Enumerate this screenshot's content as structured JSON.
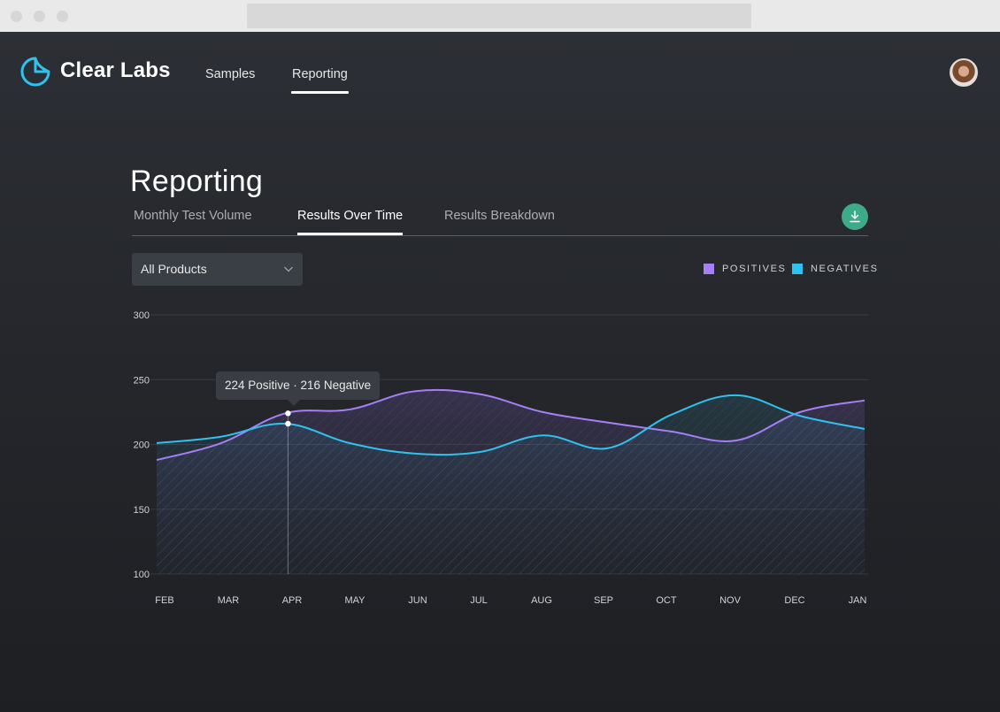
{
  "browser": {
    "url": ""
  },
  "header": {
    "brand": "Clear Labs",
    "nav": [
      {
        "label": "Samples",
        "active": false
      },
      {
        "label": "Reporting",
        "active": true
      }
    ],
    "avatar_icon": "user-avatar"
  },
  "page": {
    "title": "Reporting",
    "tabs": [
      {
        "label": "Monthly Test Volume",
        "active": false
      },
      {
        "label": "Results Over Time",
        "active": true
      },
      {
        "label": "Results Breakdown",
        "active": false
      }
    ],
    "download_icon": "download-icon",
    "product_filter": {
      "selected": "All Products",
      "icon": "chevron-down-icon"
    }
  },
  "colors": {
    "positives": "#a57ff5",
    "negatives": "#2fc2ee",
    "accent_green": "#3dab88"
  },
  "chart_data": {
    "type": "area",
    "title": "Results Over Time",
    "xlabel": "",
    "ylabel": "",
    "categories": [
      "FEB",
      "MAR",
      "APR",
      "MAY",
      "JUN",
      "JUL",
      "AUG",
      "SEP",
      "OCT",
      "NOV",
      "DEC",
      "JAN"
    ],
    "series": [
      {
        "name": "POSITIVES",
        "color": "#a57ff5",
        "values": [
          188,
          201,
          224,
          227,
          241,
          239,
          225,
          217,
          210,
          203,
          225,
          234
        ]
      },
      {
        "name": "NEGATIVES",
        "color": "#2fc2ee",
        "values": [
          201,
          206,
          216,
          201,
          193,
          194,
          207,
          197,
          223,
          238,
          222,
          212
        ]
      }
    ],
    "yticks": [
      100,
      150,
      200,
      250,
      300
    ],
    "ylim": [
      100,
      300
    ],
    "grid": true,
    "legend": "top-right",
    "tooltip": {
      "category": "APR",
      "text": "224 Positive · 216 Negative"
    }
  }
}
